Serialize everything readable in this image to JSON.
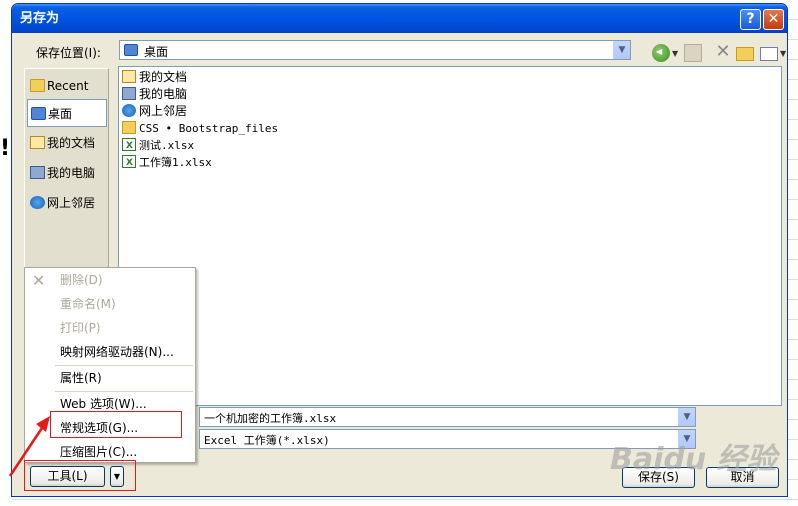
{
  "window": {
    "title": "另存为",
    "help_label": "?",
    "close_label": "✕"
  },
  "save_in": {
    "label": "保存位置(I):",
    "value": "桌面"
  },
  "places": [
    {
      "label": "Recent",
      "icon": "recent-folder-icon"
    },
    {
      "label": "桌面",
      "icon": "desktop-icon",
      "selected": true
    },
    {
      "label": "我的文档",
      "icon": "my-documents-icon"
    },
    {
      "label": "我的电脑",
      "icon": "my-computer-icon"
    },
    {
      "label": "网上邻居",
      "icon": "network-places-icon"
    }
  ],
  "files": [
    {
      "name": "我的文档",
      "icon": "my-documents-icon"
    },
    {
      "name": "我的电脑",
      "icon": "my-computer-icon"
    },
    {
      "name": "网上邻居",
      "icon": "network-places-icon"
    },
    {
      "name": "CSS • Bootstrap_files",
      "icon": "folder-icon"
    },
    {
      "name": "测试.xlsx",
      "icon": "excel-file-icon"
    },
    {
      "name": "工作簿1.xlsx",
      "icon": "excel-file-icon"
    }
  ],
  "filename": {
    "value": "一个机加密的工作簿.xlsx"
  },
  "filetype": {
    "value": "Excel 工作簿(*.xlsx)"
  },
  "buttons": {
    "save": "保存(S)",
    "cancel": "取消",
    "tools": "工具(L)"
  },
  "tools_menu": [
    {
      "label": "删除(D)",
      "disabled": true
    },
    {
      "label": "重命名(M)",
      "disabled": true
    },
    {
      "label": "打印(P)",
      "disabled": true
    },
    {
      "label": "映射网络驱动器(N)..."
    },
    {
      "label": "属性(R)"
    },
    {
      "label": "Web 选项(W)..."
    },
    {
      "label": "常规选项(G)..."
    },
    {
      "label": "压缩图片(C)..."
    }
  ],
  "watermark": "Baidu 经验",
  "colors": {
    "titlebar": "#0054e3",
    "dialog_bg": "#ece9d8",
    "annotation_red": "#e41a1a"
  }
}
